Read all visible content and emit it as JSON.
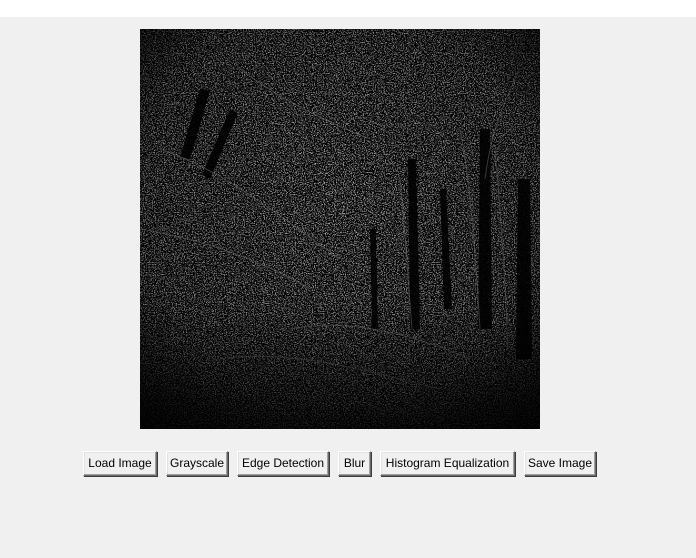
{
  "image_panel": {
    "description_icon": "processed-forest-image"
  },
  "toolbar": {
    "load_label": "Load Image",
    "grayscale_label": "Grayscale",
    "edge_label": "Edge Detection",
    "blur_label": "Blur",
    "histogram_label": "Histogram Equalization",
    "save_label": "Save Image"
  },
  "colors": {
    "client_background": "#f0f0f0",
    "canvas_background": "#000000",
    "edge_pixels": "#6e6e6e"
  }
}
